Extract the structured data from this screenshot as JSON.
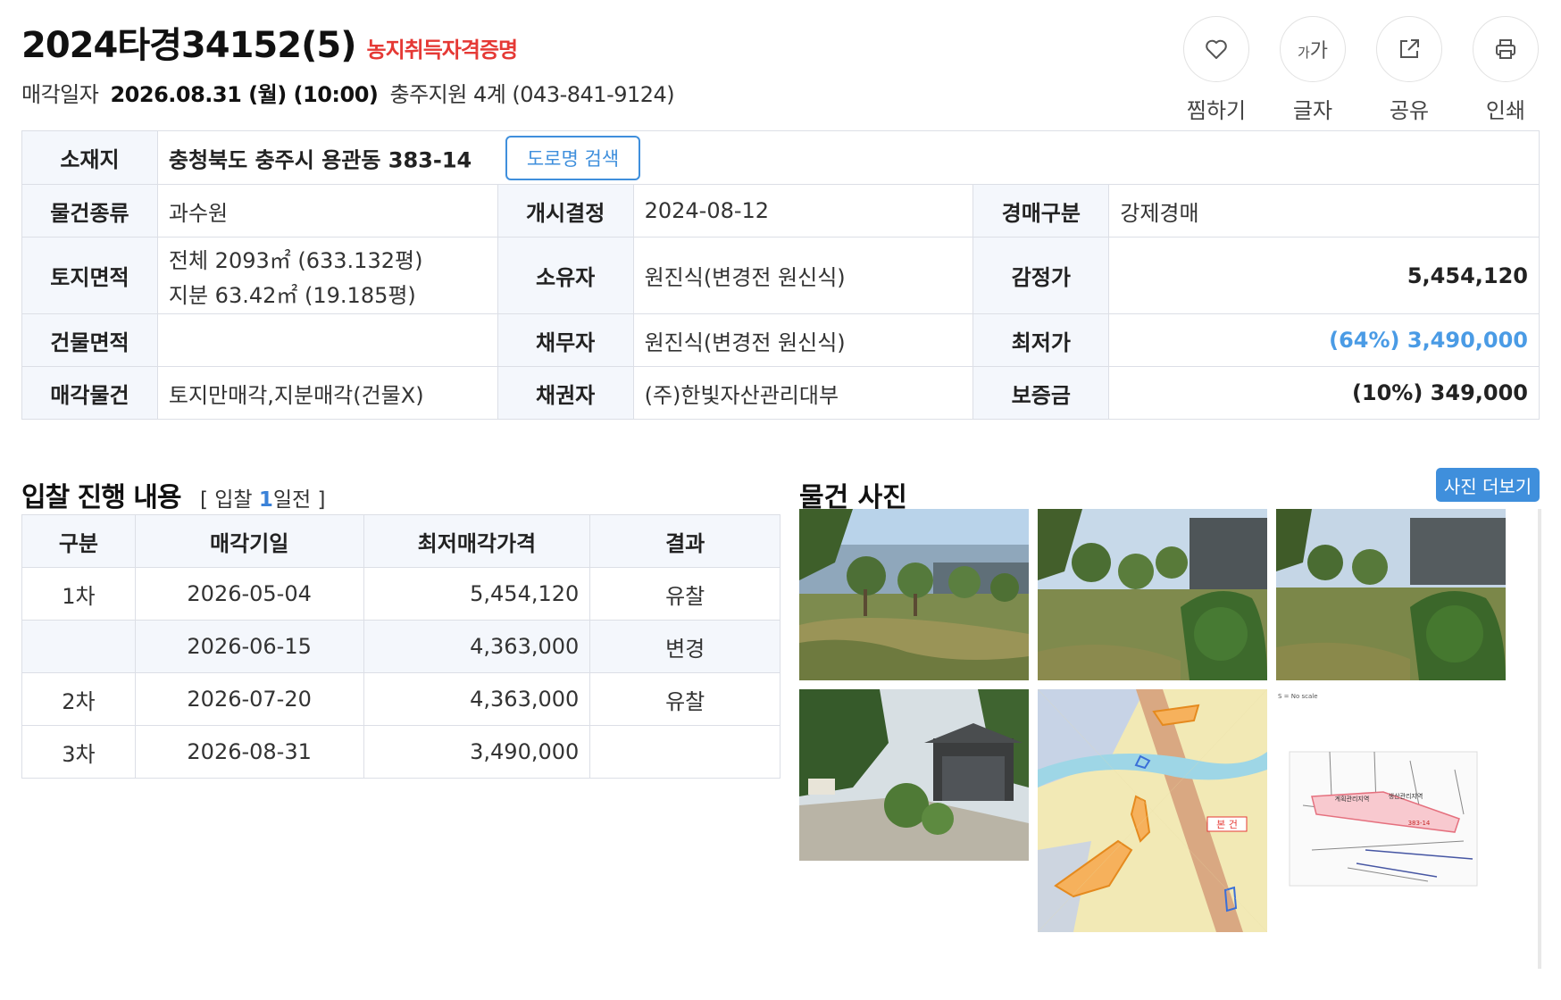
{
  "case": {
    "number": "2024타경34152(5)",
    "badge": "농지취득자격증명",
    "sale_label": "매각일자",
    "sale_date": "2026.08.31 (월) (10:00)",
    "court": "충주지원 4계 (043-841-9124)"
  },
  "actions": [
    {
      "label": "찜하기",
      "icon": "heart-icon"
    },
    {
      "label": "글자",
      "icon": "font-size-icon",
      "glyph_small": "가",
      "glyph_big": "가"
    },
    {
      "label": "공유",
      "icon": "share-icon"
    },
    {
      "label": "인쇄",
      "icon": "print-icon"
    }
  ],
  "info": {
    "location_label": "소재지",
    "location": "충청북도 충주시 용관동 383-14",
    "road_search": "도로명 검색",
    "type_label": "물건종류",
    "type": "과수원",
    "start_label": "개시결정",
    "start": "2024-08-12",
    "auction_kind_label": "경매구분",
    "auction_kind": "강제경매",
    "land_area_label": "토지면적",
    "land_area_1": "전체 2093㎡ (633.132평)",
    "land_area_2": "지분 63.42㎡ (19.185평)",
    "owner_label": "소유자",
    "owner": "원진식(변경전 원신식)",
    "appraisal_label": "감정가",
    "appraisal": "5,454,120",
    "building_area_label": "건물면적",
    "building_area": "",
    "debtor_label": "채무자",
    "debtor": "원진식(변경전 원신식)",
    "min_price_label": "최저가",
    "min_price": "(64%) 3,490,000",
    "sale_item_label": "매각물건",
    "sale_item": "토지만매각,지분매각(건물X)",
    "creditor_label": "채권자",
    "creditor": "(주)한빛자산관리대부",
    "deposit_label": "보증금",
    "deposit": "(10%) 349,000"
  },
  "bid": {
    "title": "입찰 진행 내용",
    "sub_open": "[ 입찰 ",
    "sub_days": "1",
    "sub_close": "일전 ]",
    "headers": [
      "구분",
      "매각기일",
      "최저매각가격",
      "결과"
    ],
    "rows": [
      {
        "round": "1차",
        "date": "2026-05-04",
        "price": "5,454,120",
        "result": "유찰"
      },
      {
        "round": "",
        "date": "2026-06-15",
        "price": "4,363,000",
        "result": "변경"
      },
      {
        "round": "2차",
        "date": "2026-07-20",
        "price": "4,363,000",
        "result": "유찰"
      },
      {
        "round": "3차",
        "date": "2026-08-31",
        "price": "3,490,000",
        "result": ""
      }
    ]
  },
  "photos": {
    "title": "물건 사진",
    "more": "사진 더보기",
    "items": [
      {
        "name": "orchard-photo-1"
      },
      {
        "name": "orchard-photo-2"
      },
      {
        "name": "orchard-photo-3"
      },
      {
        "name": "building-photo"
      },
      {
        "name": "cadastral-map"
      },
      {
        "name": "zoning-map"
      }
    ],
    "map_label": "본 건",
    "zoning_lot": "383-14",
    "zoning_left": "계획관리지역",
    "zoning_right": "생산관리지역",
    "scale_note": "S = No scale"
  },
  "colors": {
    "accent_red": "#e53935",
    "accent_blue": "#3f8fdc",
    "min_price_blue": "#4a9be5",
    "header_bg": "#f4f7fc"
  }
}
